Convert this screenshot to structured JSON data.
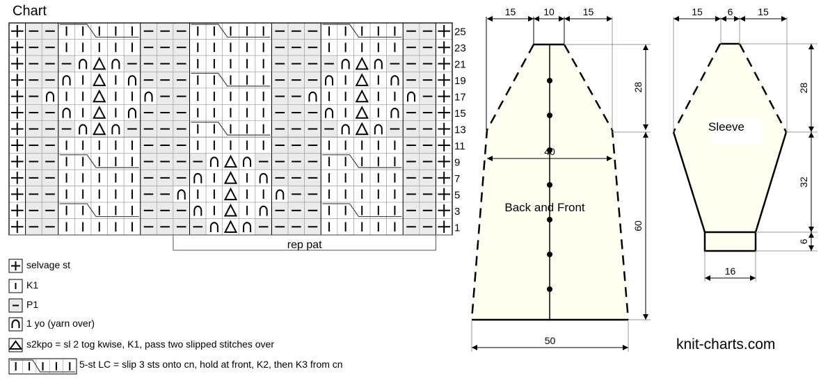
{
  "chart": {
    "title": "Chart",
    "repeat_label": "rep pat",
    "row_numbers": [
      "25",
      "23",
      "21",
      "19",
      "17",
      "15",
      "13",
      "11",
      "9",
      "7",
      "5",
      "3",
      "1"
    ],
    "symbol_codes": {
      "S": "selvage",
      "K": "knit",
      "P": "purl",
      "O": "yarn-over",
      "T": "s2kpo",
      "C": "5-st-lc-cable"
    },
    "rows": [
      "SPPCCCCCPPPCCCCCPPPCCCCCPPS",
      "SPPKKKKKPPPKKKKKPPPKKKKKPPS",
      "SPPPOTOPPPPKKKKKPPPPOTOPPPS",
      "SPPOKTKOPPPCCCCCPPPOKTKOPPS",
      "SPOKKTKKOPPKKKKKPPOKKTKKOPS",
      "SPPOKTKOPPPKKKKKPPPOKTKOPPS",
      "SPPPOTOPPPPCCCCCPPPPOTOPPPS",
      "SPPKKKKKPPPKKKKKPPPKKKKKPPS",
      "SPPCCCCCPPPPOTOPPPPCCCCCPPS",
      "SPPKKKKKPPPOKTKOPPPKKKKKPPS",
      "SPPKKKKKPPOKKTKKOPPKKKKKPPS",
      "SPPCCCCCPPPOKTKOPPPCCCCCPPS",
      "SPPKKKKKPPPPOTOPPPPKKKKKPPS"
    ],
    "purl_fill": "#ebebeb"
  },
  "legend": [
    {
      "symbol": "S",
      "text": "selvage st"
    },
    {
      "symbol": "K",
      "text": "K1"
    },
    {
      "symbol": "P",
      "text": "P1"
    },
    {
      "symbol": "O",
      "text": "1 yo (yarn over)"
    },
    {
      "symbol": "T",
      "text": "s2kpo = sl 2 tog kwise, K1, pass two slipped stitches over"
    },
    {
      "symbol": "C",
      "text": "5-st LC =  slip 3 sts onto cn, hold at front, K2, then K3 from cn"
    }
  ],
  "back_front": {
    "label": "Back and Front",
    "dims": {
      "top_left": "15",
      "neck": "10",
      "top_right": "15",
      "armhole_height": "28",
      "width_at_armhole": "40",
      "body_height": "60",
      "bottom_width": "50"
    }
  },
  "sleeve": {
    "label": "Sleeve",
    "dims": {
      "top_left": "15",
      "top": "6",
      "top_right": "15",
      "cap_height": "28",
      "sleeve_length": "32",
      "cuff_height": "6",
      "cuff_width": "16"
    }
  },
  "fill_color": "#fffff2",
  "site": "knit-charts.com"
}
